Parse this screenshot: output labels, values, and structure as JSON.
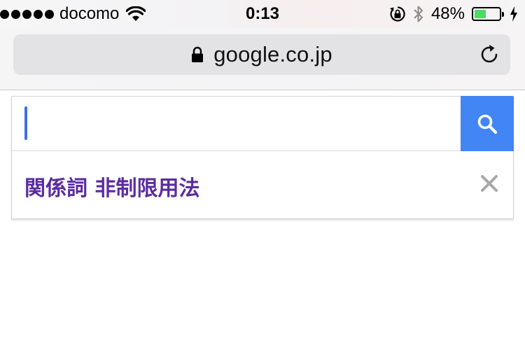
{
  "status_bar": {
    "carrier": "docomo",
    "time": "0:13",
    "battery_percent": "48%",
    "battery_level": 0.48,
    "signal_bars": 5,
    "icons": [
      "signal-dots-icon",
      "wifi-icon",
      "rotation-lock-icon",
      "bluetooth-icon",
      "battery-icon",
      "charging-bolt-icon"
    ]
  },
  "browser": {
    "url": "google.co.jp",
    "icons": [
      "lock-icon",
      "reload-icon"
    ]
  },
  "search": {
    "input_value": "",
    "button_icon": "search-icon",
    "suggestions": [
      {
        "text": "関係詞 非制限用法",
        "remove_icon": "close-icon"
      }
    ]
  },
  "colors": {
    "search_button": "#4285f4",
    "suggestion_text": "#5b2ca0",
    "battery_fill": "#4cd964",
    "caret": "#3f6fe0"
  }
}
